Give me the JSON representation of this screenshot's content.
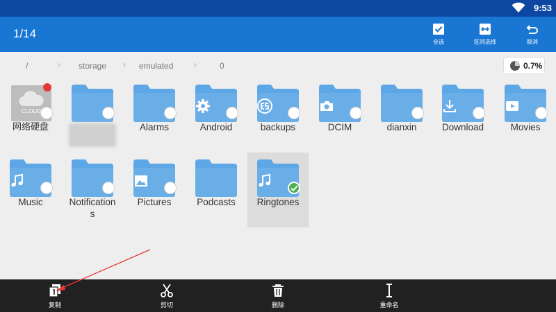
{
  "status_bar": {
    "time": "9:53",
    "icons": [
      "wifi-icon"
    ]
  },
  "toolbar": {
    "counter": "1/14",
    "actions": [
      {
        "label": "全选",
        "icon": "select-all-icon"
      },
      {
        "label": "区间选择",
        "icon": "range-select-icon"
      },
      {
        "label": "取消",
        "icon": "cancel-icon"
      }
    ]
  },
  "breadcrumb": [
    "/",
    "storage",
    "emulated",
    "0"
  ],
  "storage_usage": "0.7%",
  "items": [
    {
      "name": "网络硬盘",
      "type": "cloud",
      "cloud_label": "CLOUD",
      "badge": "notification-dot"
    },
    {
      "name": "",
      "type": "folder",
      "name_obscured": true
    },
    {
      "name": "Alarms",
      "type": "folder"
    },
    {
      "name": "Android",
      "type": "folder",
      "icon": "gear-icon"
    },
    {
      "name": "backups",
      "type": "folder",
      "icon": "es-logo-icon"
    },
    {
      "name": "DCIM",
      "type": "folder",
      "icon": "camera-icon"
    },
    {
      "name": "dianxin",
      "type": "folder"
    },
    {
      "name": "Download",
      "type": "folder",
      "icon": "download-icon"
    },
    {
      "name": "Movies",
      "type": "folder",
      "icon": "play-icon"
    },
    {
      "name": "Music",
      "type": "folder",
      "icon": "music-note-icon"
    },
    {
      "name": "Notification\ns",
      "type": "folder",
      "icon": "bell-icon"
    },
    {
      "name": "Pictures",
      "type": "folder",
      "icon": "image-icon"
    },
    {
      "name": "Podcasts",
      "type": "folder"
    },
    {
      "name": "Ringtones",
      "type": "folder",
      "icon": "music-note-icon",
      "selected": true
    }
  ],
  "bottom_actions": [
    {
      "label": "复制",
      "icon": "copy-icon"
    },
    {
      "label": "剪切",
      "icon": "scissors-icon"
    },
    {
      "label": "删除",
      "icon": "trash-icon"
    },
    {
      "label": "重命名",
      "icon": "rename-icon"
    }
  ],
  "colors": {
    "status_bar": "#0d47a1",
    "toolbar": "#1976d2",
    "folder": "#5ea7e6",
    "folder_tab": "#7bb8ec",
    "background": "#eeeeee",
    "bottom_bar": "#212121",
    "selected_check": "#4caf50",
    "annotation_arrow": "#e53935"
  }
}
